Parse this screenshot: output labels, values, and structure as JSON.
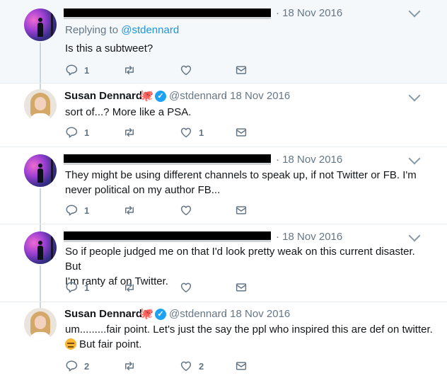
{
  "tweets": [
    {
      "name": "",
      "handle": "",
      "date": "· 18 Nov 2016",
      "reply_prefix": "Replying to",
      "reply_to": "@stdennard",
      "lines": [
        "Is this a subtweet?"
      ],
      "replies": "1",
      "retweets": "",
      "likes": ""
    },
    {
      "name": "Susan Dennard",
      "handle": "@stdennard",
      "date": "· 18 Nov 2016",
      "lines": [
        "sort of...? More like a PSA."
      ],
      "replies": "1",
      "retweets": "",
      "likes": "1"
    },
    {
      "name": "",
      "handle": "",
      "date": "· 18 Nov 2016",
      "lines": [
        "They might be using different channels to speak up, if not Twitter or FB. I'm",
        "never political on my author FB..."
      ],
      "replies": "1",
      "retweets": "",
      "likes": ""
    },
    {
      "name": "",
      "handle": "",
      "date": "· 18 Nov 2016",
      "lines": [
        "So if people judged me on that I'd look pretty weak on this current disaster. But",
        "I'm ranty af on Twitter."
      ],
      "replies": "1",
      "retweets": "",
      "likes": ""
    },
    {
      "name": "Susan Dennard",
      "handle": "@stdennard",
      "date": "· 18 Nov 2016",
      "lines": [
        "um.........fair point. Let's just the say the ppl who inspired this are def on twitter.",
        "But fair point."
      ],
      "replies": "2",
      "retweets": "",
      "likes": "2"
    }
  ],
  "icons": {
    "reply": "reply-icon",
    "retweet": "retweet-icon",
    "like": "heart-icon",
    "dm": "envelope-icon",
    "menu": "chevron-down-icon",
    "verified": "verified-badge-icon",
    "octopus": "octopus-emoji",
    "expressionless": "expressionless-face-emoji"
  },
  "colors": {
    "link": "#1b95e0",
    "verified": "#1da1f2",
    "muted": "#657786",
    "highlight_bg": "#f5f8fa"
  }
}
